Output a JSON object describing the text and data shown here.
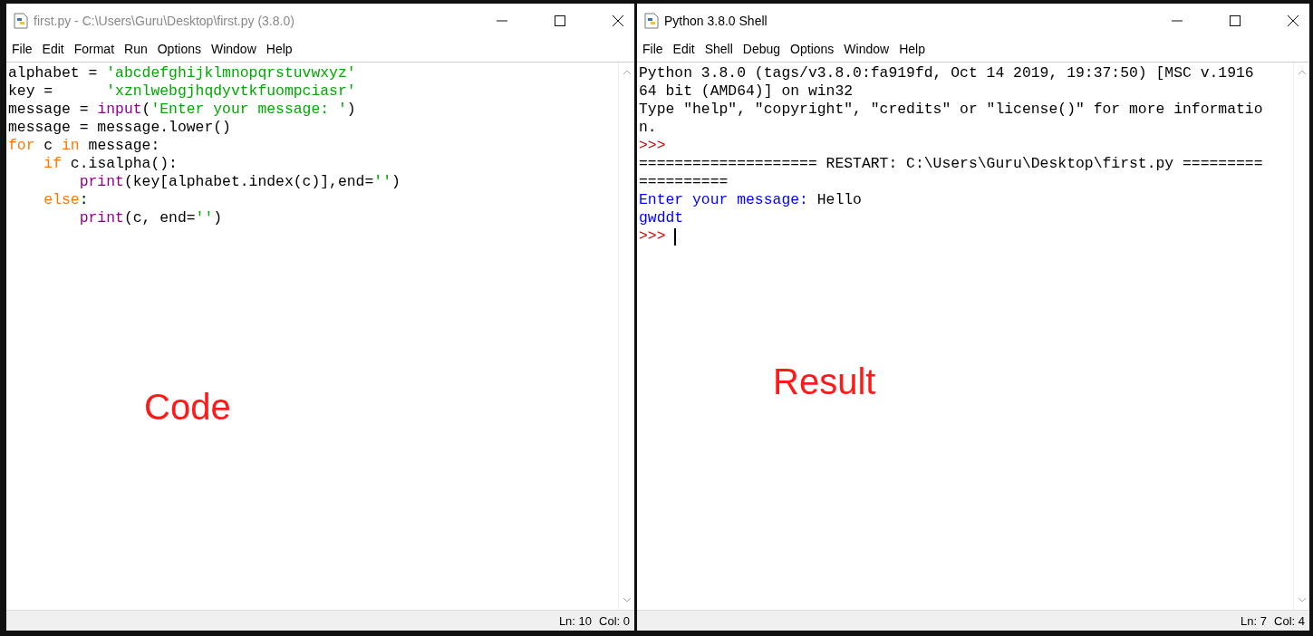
{
  "windows": [
    {
      "title": "first.py - C:\\Users\\Guru\\Desktop\\first.py (3.8.0)",
      "title_active": false,
      "menu": [
        "File",
        "Edit",
        "Format",
        "Run",
        "Options",
        "Window",
        "Help"
      ],
      "lines": [
        [
          {
            "kind": "plain",
            "text": "alphabet = "
          },
          {
            "kind": "string",
            "text": "'abcdefghijklmnopqrstuvwxyz'"
          }
        ],
        [
          {
            "kind": "plain",
            "text": "key =      "
          },
          {
            "kind": "string",
            "text": "'xznlwebgjhqdyvtkfuompciasr'"
          }
        ],
        [
          {
            "kind": "plain",
            "text": "message = "
          },
          {
            "kind": "builtin",
            "text": "input"
          },
          {
            "kind": "plain",
            "text": "("
          },
          {
            "kind": "string",
            "text": "'Enter your message: '"
          },
          {
            "kind": "plain",
            "text": ")"
          }
        ],
        [
          {
            "kind": "plain",
            "text": "message = message.lower()"
          }
        ],
        [
          {
            "kind": "keyword",
            "text": "for"
          },
          {
            "kind": "plain",
            "text": " c "
          },
          {
            "kind": "keyword",
            "text": "in"
          },
          {
            "kind": "plain",
            "text": " message:"
          }
        ],
        [
          {
            "kind": "keyword",
            "text": "    if"
          },
          {
            "kind": "plain",
            "text": " c.isalpha():"
          }
        ],
        [
          {
            "kind": "builtin",
            "text": "        print"
          },
          {
            "kind": "plain",
            "text": "(key[alphabet.index(c)],end="
          },
          {
            "kind": "string",
            "text": "''"
          },
          {
            "kind": "plain",
            "text": ")"
          }
        ],
        [
          {
            "kind": "keyword",
            "text": "    else"
          },
          {
            "kind": "plain",
            "text": ":"
          }
        ],
        [
          {
            "kind": "builtin",
            "text": "        print"
          },
          {
            "kind": "plain",
            "text": "(c, end="
          },
          {
            "kind": "string",
            "text": "''"
          },
          {
            "kind": "plain",
            "text": ")"
          }
        ]
      ],
      "cursor": false,
      "annotation": "Code",
      "status": {
        "line": "Ln: 10",
        "col": "Col: 0"
      }
    },
    {
      "title": "Python 3.8.0 Shell",
      "title_active": true,
      "menu": [
        "File",
        "Edit",
        "Shell",
        "Debug",
        "Options",
        "Window",
        "Help"
      ],
      "lines": [
        [
          {
            "kind": "plain",
            "text": "Python 3.8.0 (tags/v3.8.0:fa919fd, Oct 14 2019, 19:37:50) [MSC v.1916"
          }
        ],
        [
          {
            "kind": "plain",
            "text": "64 bit (AMD64)] on win32"
          }
        ],
        [
          {
            "kind": "plain",
            "text": "Type \"help\", \"copyright\", \"credits\" or \"license()\" for more informatio"
          }
        ],
        [
          {
            "kind": "plain",
            "text": "n."
          }
        ],
        [
          {
            "kind": "prompt",
            "text": ">>>"
          }
        ],
        [
          {
            "kind": "plain",
            "text": "==================== RESTART: C:\\Users\\Guru\\Desktop\\first.py ========="
          }
        ],
        [
          {
            "kind": "plain",
            "text": "=========="
          }
        ],
        [
          {
            "kind": "stdout",
            "text": "Enter your message: "
          },
          {
            "kind": "plain",
            "text": "Hello"
          }
        ],
        [
          {
            "kind": "stdout",
            "text": "gwddt"
          }
        ],
        [
          {
            "kind": "prompt",
            "text": ">>> "
          }
        ]
      ],
      "cursor": true,
      "annotation": "Result",
      "status": {
        "line": "Ln: 7",
        "col": "Col: 4"
      }
    }
  ]
}
